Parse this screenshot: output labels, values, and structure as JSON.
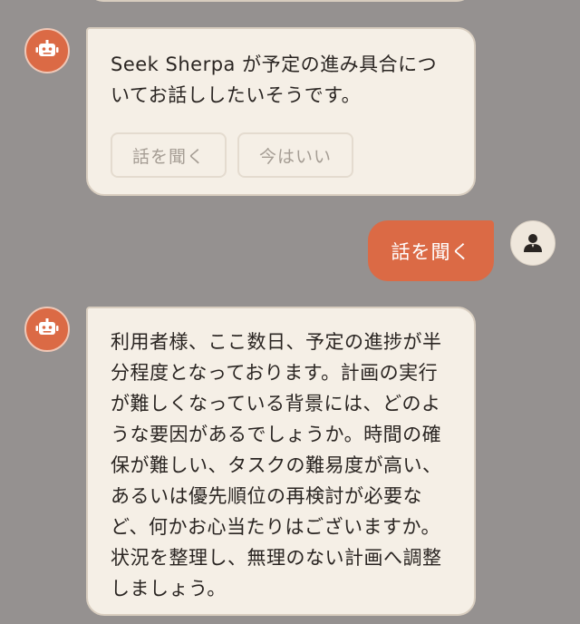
{
  "colors": {
    "background": "#959190",
    "bubble": "#f5efe6",
    "accent": "#db6a45",
    "text": "#2a2522"
  },
  "messages": [
    {
      "role": "bot",
      "avatar_icon": "robot-icon",
      "text": "Seek Sherpa が予定の進み具合についてお話ししたいそうです。",
      "choices": [
        {
          "label": "話を聞く",
          "state": "disabled"
        },
        {
          "label": "今はいい",
          "state": "disabled"
        }
      ]
    },
    {
      "role": "user",
      "avatar_icon": "user-icon",
      "text": "話を聞く"
    },
    {
      "role": "bot",
      "avatar_icon": "robot-icon",
      "text": "利用者様、ここ数日、予定の進捗が半分程度となっております。計画の実行が難しくなっている背景には、どのような要因があるでしょうか。時間の確保が難しい、タスクの難易度が高い、あるいは優先順位の再検討が必要など、何かお心当たりはございますか。状況を整理し、無理のない計画へ調整しましょう。"
    }
  ]
}
